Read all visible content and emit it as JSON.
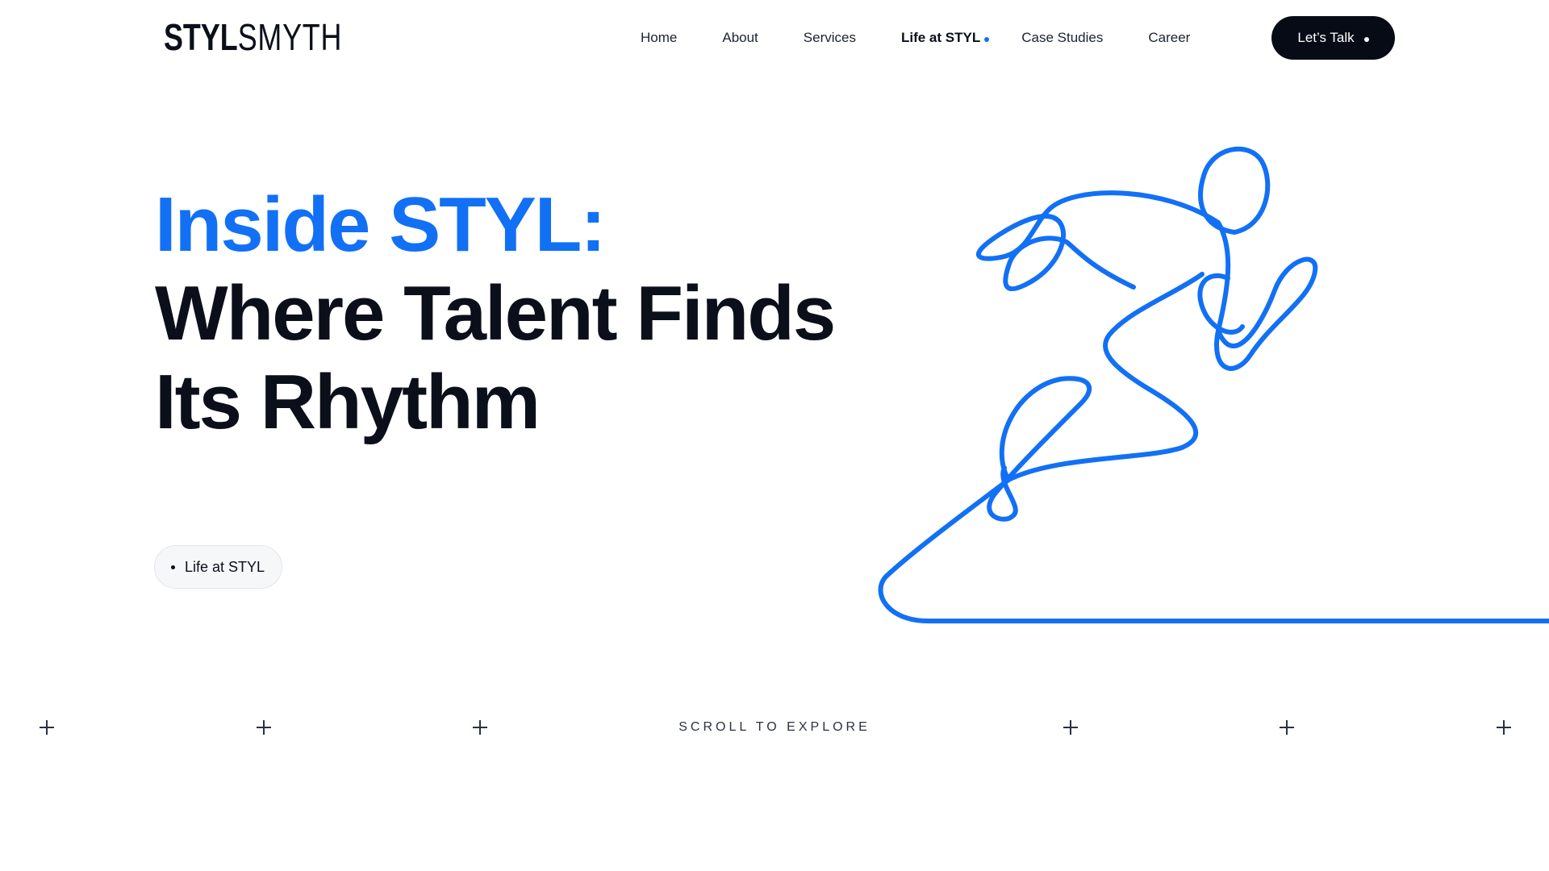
{
  "header": {
    "logo_bold": "STYL",
    "logo_light": "SMYTH",
    "nav": [
      {
        "label": "Home"
      },
      {
        "label": "About"
      },
      {
        "label": "Services"
      },
      {
        "label": "Life at STYL",
        "active": true
      },
      {
        "label": "Case Studies"
      },
      {
        "label": "Career"
      }
    ],
    "cta_label": "Let’s Talk"
  },
  "hero": {
    "title_accent": "Inside STYL:",
    "title_line_2": "Where Talent Finds",
    "title_line_3": "Its Rhythm",
    "pill_label": "Life at STYL",
    "illustration_icon": "runner-line-art-icon"
  },
  "scroll": {
    "label": "SCROLL TO EXPLORE",
    "marker_icon": "plus-icon"
  },
  "colors": {
    "accent": "#1270f5",
    "text_dark": "#0b0f1a",
    "cta_bg": "#070b16",
    "pill_bg": "#f6f7f9"
  }
}
